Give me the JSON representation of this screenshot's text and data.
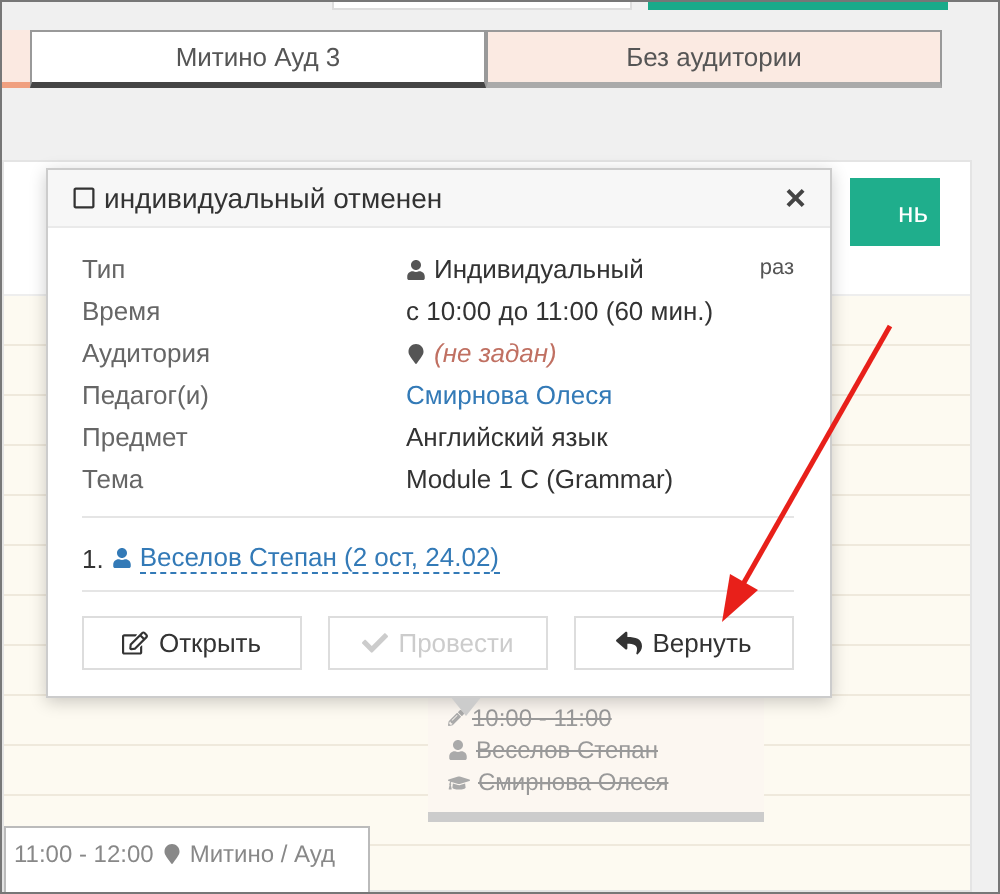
{
  "tabs": [
    {
      "label": "Митино Ауд 3",
      "selected": true
    },
    {
      "label": "Без аудитории",
      "selected": false
    }
  ],
  "green_button": {
    "label": "нь"
  },
  "popup": {
    "title": "индивидуальный отменен",
    "checked": false,
    "close": "×",
    "side_note": "раз",
    "rows": [
      {
        "label": "Тип",
        "value": "Индивидуальный",
        "kind": "person"
      },
      {
        "label": "Время",
        "value": "с 10:00 до 11:00 (60 мин.)",
        "kind": "plain"
      },
      {
        "label": "Аудитория",
        "value": "(не задан)",
        "kind": "location"
      },
      {
        "label": "Педагог(и)",
        "value": "Смирнова Олеся",
        "kind": "link"
      },
      {
        "label": "Предмет",
        "value": "Английский язык",
        "kind": "plain"
      },
      {
        "label": "Тема",
        "value": "Module 1 C (Grammar)",
        "kind": "plain"
      }
    ],
    "students": [
      {
        "number": "1.",
        "name": "Веселов Степан (2 ост, 24.02)"
      }
    ],
    "buttons": [
      {
        "label": "Открыть",
        "kind": "open",
        "disabled": false
      },
      {
        "label": "Провести",
        "kind": "conduct",
        "disabled": true
      },
      {
        "label": "Вернуть",
        "kind": "revert",
        "disabled": false
      }
    ]
  },
  "lesson_card": {
    "time": "10:00 - 11:00",
    "student": "Веселов Степан",
    "teacher": "Смирнова Олеся",
    "cancelled": true
  },
  "next_card": {
    "time": "11:00 - 12:00",
    "location": "Митино / Ауд"
  }
}
